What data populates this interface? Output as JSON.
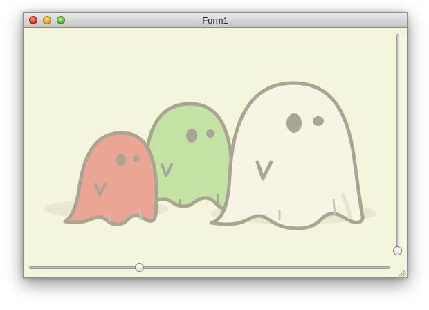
{
  "window": {
    "title": "Form1"
  },
  "canvas": {
    "background": "#f5f4dd",
    "image_description_icon": "ghosts-illustration",
    "ghost_colors": [
      "#eba595",
      "#c2e3a4",
      "#f7f4e6"
    ],
    "outline_color": "#a8a592"
  },
  "sliders": {
    "horizontal": {
      "value_fraction": 0.3
    },
    "vertical": {
      "value_fraction": 0.0
    }
  },
  "icons": {
    "close": "close-icon",
    "minimize": "minimize-icon",
    "zoom": "zoom-icon",
    "resize_grip": "resize-grip-icon"
  }
}
